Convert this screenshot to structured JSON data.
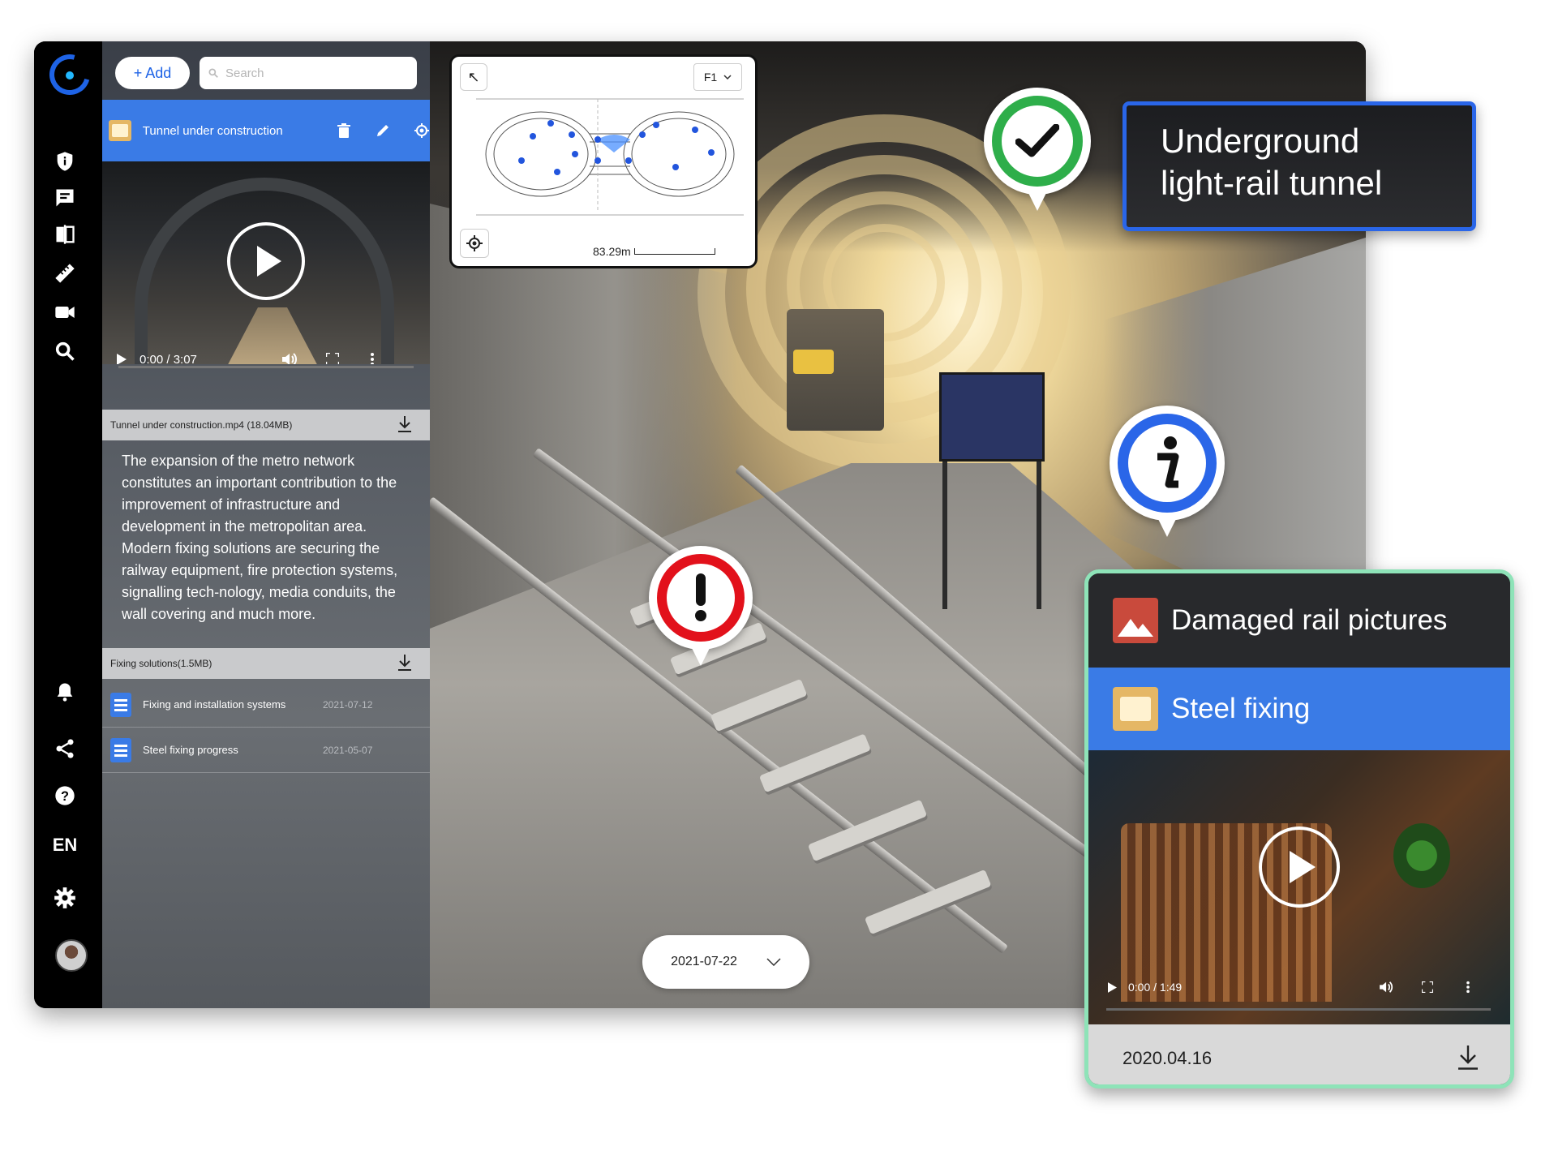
{
  "toolbar": {
    "add_label": "+ Add",
    "search_placeholder": "Search"
  },
  "rail": {
    "language": "EN"
  },
  "panel": {
    "active_item": {
      "title": "Tunnel under construction",
      "icon": "film-icon"
    },
    "video": {
      "time": "0:00 / 3:07",
      "icon": "play-icon"
    },
    "attachment": {
      "filename": "Tunnel under construction.mp4 (18.04MB)"
    },
    "description": "The expansion of the metro network constitutes an important contribution to the improvement of infrastructure and development in the metropolitan area. Modern fixing solutions are securing the railway equipment, fire protection systems, signalling tech-nology, media conduits, the wall covering and much more.",
    "attachment2": {
      "filename": "Fixing solutions(1.5MB)"
    },
    "list": [
      {
        "title": "Fixing and installation systems",
        "date": "2021-07-12"
      },
      {
        "title": "Steel fixing progress",
        "date": "2021-05-07"
      }
    ]
  },
  "minimap": {
    "floor": "F1",
    "scale": "83.29m"
  },
  "viewer": {
    "date": "2021-07-22"
  },
  "callout": {
    "line1": "Underground",
    "line2": "light-rail tunnel"
  },
  "card": {
    "header": "Damaged rail pictures",
    "selected": "Steel fixing",
    "video_time": "0:00 / 1:49",
    "date": "2020.04.16"
  },
  "colors": {
    "accent": "#3a7be6",
    "brand": "#1e63e6",
    "pin_ok": "#2eae4a",
    "pin_alert": "#e2111b",
    "pin_info": "#2a66e8",
    "card_border": "#8ee3b8"
  }
}
